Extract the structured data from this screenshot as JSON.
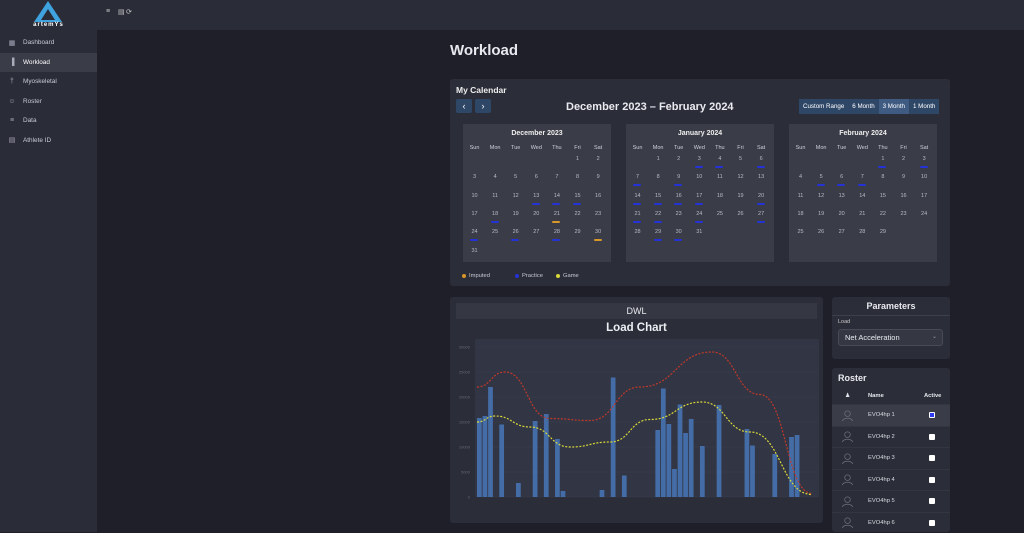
{
  "app": {
    "logo_text": "artemYs"
  },
  "sidebar": {
    "items": [
      {
        "label": "Dashboard",
        "icon": "grid-icon"
      },
      {
        "label": "Workload",
        "icon": "bar-chart-icon"
      },
      {
        "label": "Myoskeletal",
        "icon": "skeleton-icon"
      },
      {
        "label": "Roster",
        "icon": "people-icon"
      },
      {
        "label": "Data",
        "icon": "database-icon"
      },
      {
        "label": "Athlete ID",
        "icon": "id-card-icon"
      }
    ]
  },
  "page": {
    "title": "Workload"
  },
  "calendar": {
    "title": "My Calendar",
    "range_title": "December 2023 – February 2024",
    "range_buttons": [
      "Custom Range",
      "6 Month",
      "3 Month",
      "1 Month"
    ],
    "weekdays": [
      "Sun",
      "Mon",
      "Tue",
      "Wed",
      "Thu",
      "Fri",
      "Sat"
    ],
    "months": [
      {
        "title": "December 2023",
        "start": 5,
        "days": 31,
        "practice": [
          13,
          14,
          15,
          18,
          24,
          26,
          28
        ],
        "imputed": [
          21,
          30
        ]
      },
      {
        "title": "January 2024",
        "start": 1,
        "days": 31,
        "practice": [
          3,
          4,
          6,
          7,
          9,
          14,
          15,
          16,
          17,
          20,
          21,
          22,
          24,
          27,
          29,
          30
        ],
        "imputed": []
      },
      {
        "title": "February 2024",
        "start": 4,
        "days": 29,
        "practice": [
          1,
          3,
          5,
          6,
          7
        ],
        "imputed": []
      }
    ],
    "legend": [
      {
        "label": "Imputed",
        "color": "#d9972a"
      },
      {
        "label": "Practice",
        "color": "#2432d6"
      },
      {
        "label": "Game",
        "color": "#d8d83a"
      }
    ]
  },
  "chart": {
    "section_title": "DWL",
    "title": "Load Chart"
  },
  "chart_data": {
    "type": "bar",
    "yticks": [
      0,
      5000,
      10000,
      15000,
      20000,
      25000,
      30000
    ],
    "ylim": [
      0,
      31000
    ],
    "values": [
      15800,
      16200,
      22000,
      0,
      14500,
      0,
      0,
      2800,
      0,
      0,
      15200,
      0,
      16600,
      0,
      11600,
      1200,
      0,
      0,
      0,
      0,
      0,
      0,
      1400,
      0,
      23900,
      0,
      4300,
      0,
      0,
      0,
      0,
      0,
      13400,
      21700,
      14600,
      5600,
      18500,
      12800,
      15600,
      0,
      10200,
      0,
      0,
      18400,
      0,
      0,
      0,
      0,
      13600,
      10300,
      0,
      0,
      0,
      8600,
      0,
      0,
      12000,
      12400,
      0,
      0,
      0
    ],
    "series": [
      {
        "name": "upper",
        "color": "#c0392b"
      },
      {
        "name": "lower",
        "color": "#d8d83a"
      }
    ]
  },
  "parameters": {
    "title": "Parameters",
    "load_label": "Load",
    "load_value": "Net Acceleration"
  },
  "roster": {
    "title": "Roster",
    "col_name": "Name",
    "col_active": "Active",
    "rows": [
      {
        "name": "EVO4hp 1",
        "active": true
      },
      {
        "name": "EVO4hp 2",
        "active": false
      },
      {
        "name": "EVO4hp 3",
        "active": false
      },
      {
        "name": "EVO4hp 4",
        "active": false
      },
      {
        "name": "EVO4hp 5",
        "active": false
      },
      {
        "name": "EVO4hp 6",
        "active": false
      }
    ]
  }
}
